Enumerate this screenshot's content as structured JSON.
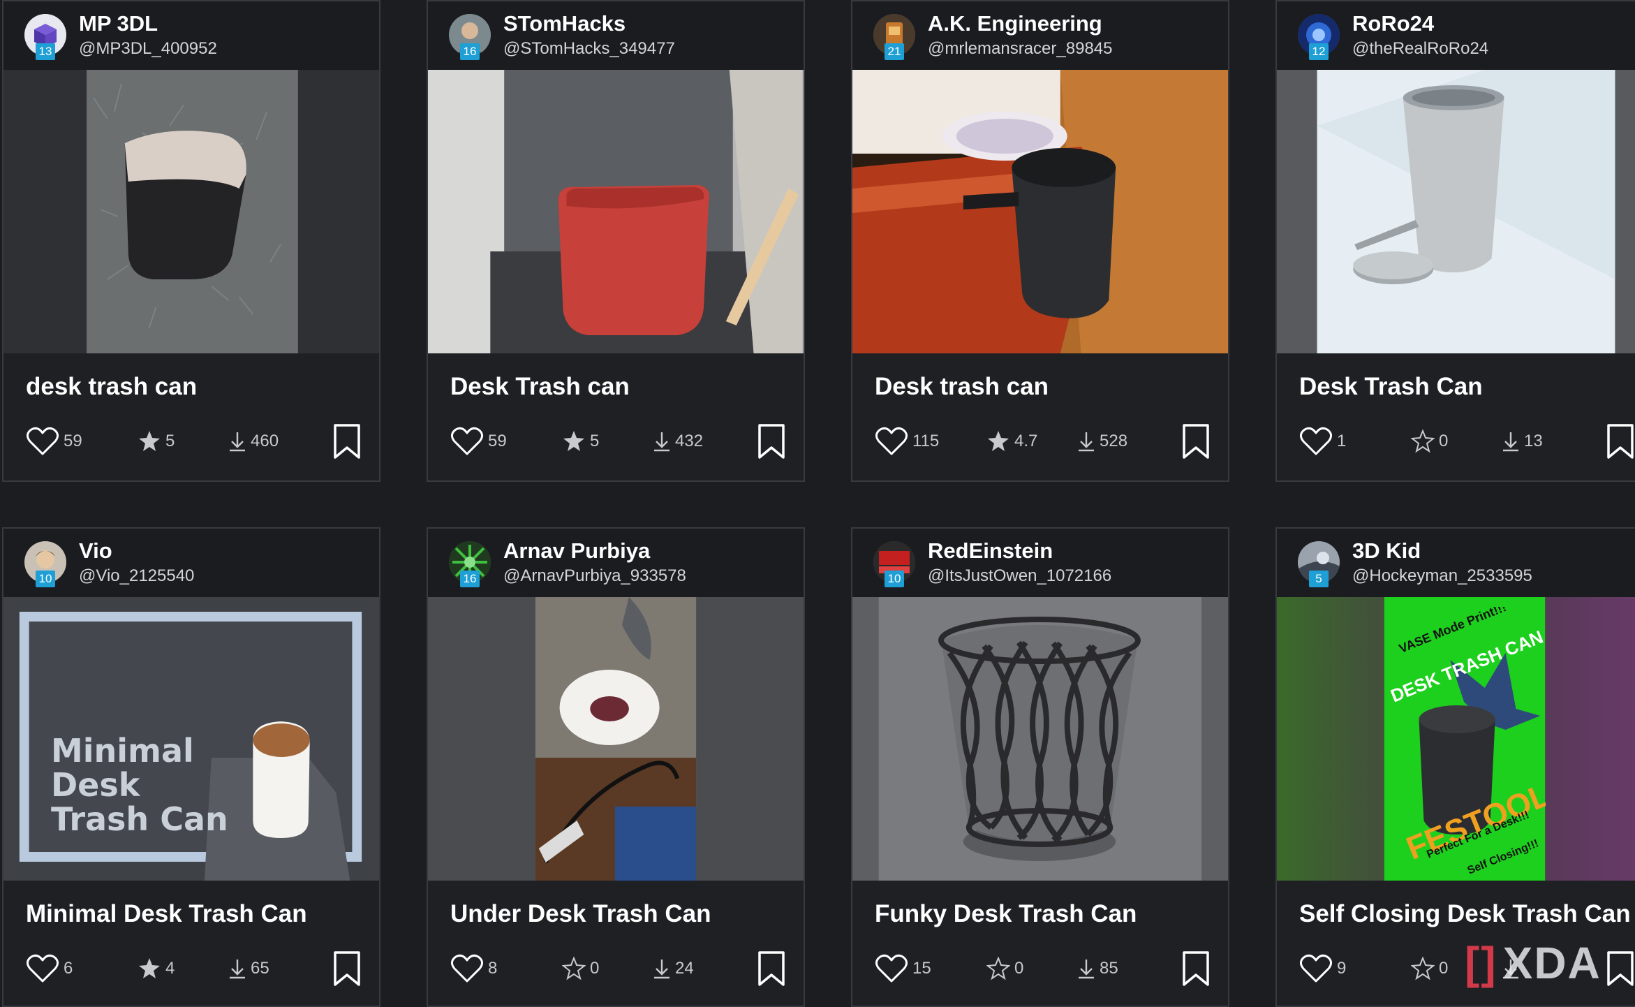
{
  "cards": [
    {
      "name": "MP 3DL",
      "handle": "@MP3DL_400952",
      "level": "13",
      "title": "desk trash can",
      "likes": "59",
      "stars": "5",
      "downloads": "460",
      "star_filled": true
    },
    {
      "name": "STomHacks",
      "handle": "@STomHacks_349477",
      "level": "16",
      "title": "Desk Trash can",
      "likes": "59",
      "stars": "5",
      "downloads": "432",
      "star_filled": true
    },
    {
      "name": "A.K. Engineering",
      "handle": "@mrlemansracer_89845",
      "level": "21",
      "title": "Desk trash can",
      "likes": "115",
      "stars": "4.7",
      "downloads": "528",
      "star_filled": true
    },
    {
      "name": "RoRo24",
      "handle": "@theRealRoRo24",
      "level": "12",
      "title": "Desk Trash Can",
      "likes": "1",
      "stars": "0",
      "downloads": "13",
      "star_filled": false
    },
    {
      "name": "Vio",
      "handle": "@Vio_2125540",
      "level": "10",
      "title": "Minimal Desk Trash Can",
      "likes": "6",
      "stars": "4",
      "downloads": "65",
      "star_filled": true,
      "image_text": [
        "Minimal",
        "Desk",
        "Trash Can"
      ]
    },
    {
      "name": "Arnav Purbiya",
      "handle": "@ArnavPurbiya_933578",
      "level": "16",
      "title": "Under Desk Trash Can",
      "likes": "8",
      "stars": "0",
      "downloads": "24",
      "star_filled": false
    },
    {
      "name": "RedEinstein",
      "handle": "@ItsJustOwen_1072166",
      "level": "10",
      "title": "Funky Desk Trash Can",
      "likes": "15",
      "stars": "0",
      "downloads": "85",
      "star_filled": false
    },
    {
      "name": "3D Kid",
      "handle": "@Hockeyman_2533595",
      "level": "5",
      "title": "Self Closing Desk Trash Can",
      "likes": "9",
      "stars": "0",
      "downloads": "",
      "star_filled": false,
      "image_text": [
        "VASE Mode Print!!!",
        "DESK TRASH CAN",
        "FESTOOL",
        "Perfect For a Desk!!!",
        "Self Closing!!!"
      ]
    }
  ],
  "watermark": {
    "bracket": "[]",
    "text": "XDA"
  },
  "colors": {
    "background": "#1c1d21",
    "card": "#1f2024",
    "badge": "#1e9fd6",
    "stat_text": "#c9cace"
  }
}
